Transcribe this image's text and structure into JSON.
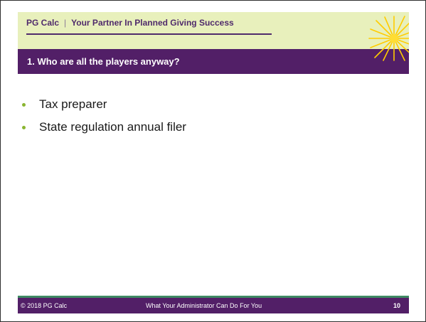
{
  "header": {
    "brand": "PG Calc",
    "separator": "|",
    "tagline": "Your Partner In Planned Giving Success"
  },
  "slide": {
    "title": "1. Who are all the players anyway?",
    "bullets": [
      "Tax preparer",
      "State regulation annual filer"
    ]
  },
  "footer": {
    "copyright": "© 2018 PG Calc",
    "presentation_title": "What Your Administrator Can Do For You",
    "page_number": "10"
  },
  "colors": {
    "header_background": "#e8f0bc",
    "title_bar": "#521f67",
    "bullet": "#8ab530",
    "footer_rule": "#3f8a63",
    "burst": "#ffcc00"
  },
  "icons": {
    "logo": "starburst-logo-icon",
    "bullet": "bullet-dot-icon"
  }
}
